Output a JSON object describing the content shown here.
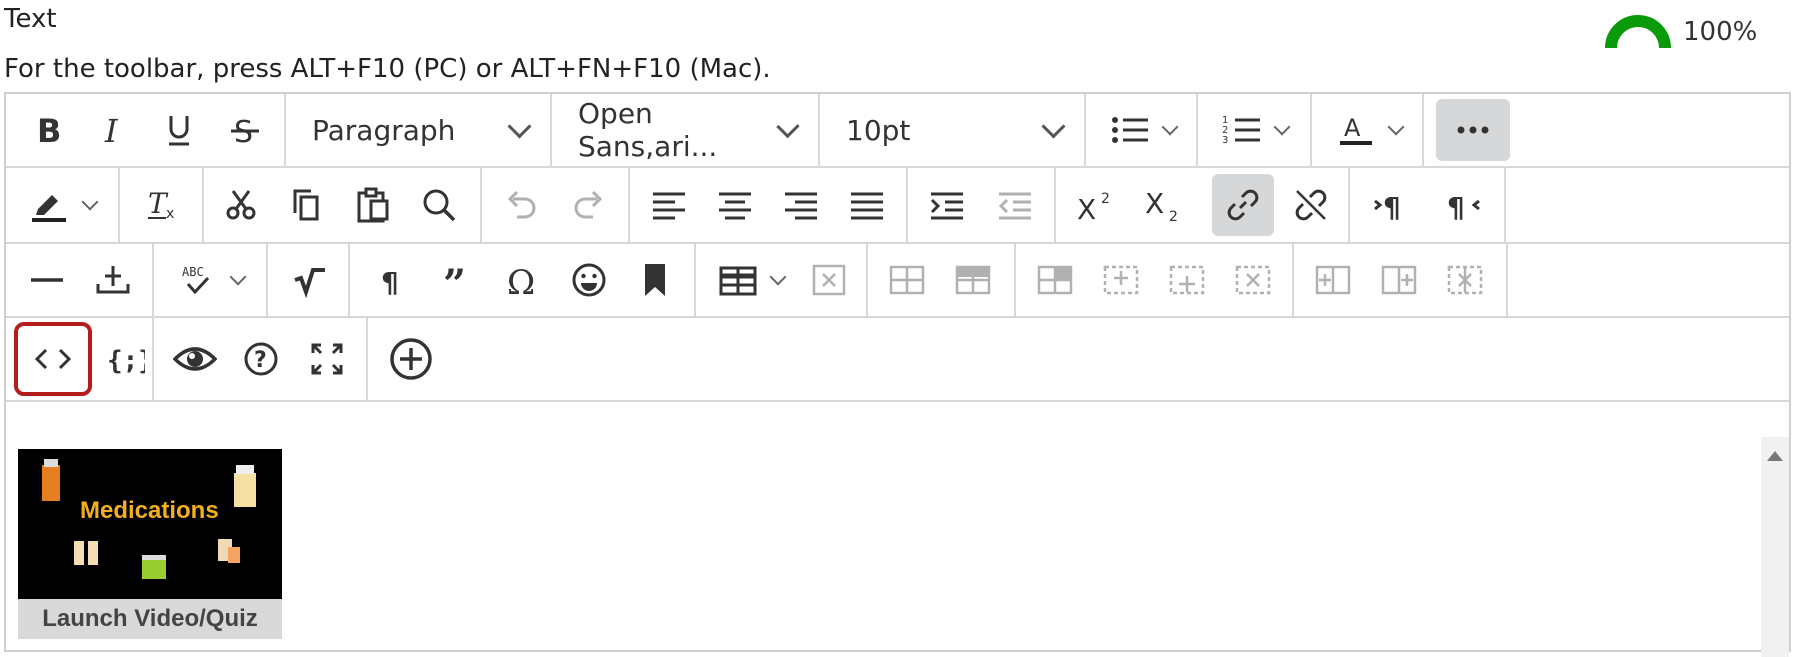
{
  "field": {
    "label": "Text",
    "hint": "For the toolbar, press ALT+F10 (PC) or ALT+FN+F10 (Mac)."
  },
  "progress": {
    "text": "100%",
    "value": 1.0,
    "color": "#0a9a0a"
  },
  "toolbar": {
    "block_format": "Paragraph",
    "font_family": "Open Sans,ari...",
    "font_size": "10pt"
  },
  "content": {
    "thumbnail_title": "Medications",
    "launch_label": "Launch Video/Quiz"
  },
  "icons": [
    "bold-icon",
    "italic-icon",
    "underline-icon",
    "strikethrough-icon",
    "bullet-list-icon",
    "numbered-list-icon",
    "text-color-icon",
    "more-icon",
    "highlight-icon",
    "clear-format-icon",
    "cut-icon",
    "copy-icon",
    "paste-icon",
    "find-icon",
    "undo-icon",
    "redo-icon",
    "align-left-icon",
    "align-center-icon",
    "align-right-icon",
    "justify-icon",
    "indent-icon",
    "outdent-icon",
    "superscript-icon",
    "subscript-icon",
    "link-icon",
    "unlink-icon",
    "ltr-icon",
    "rtl-icon",
    "horizontal-line-icon",
    "insert-icon",
    "spellcheck-icon",
    "math-icon",
    "paragraph-mark-icon",
    "blockquote-icon",
    "omega-icon",
    "emoji-icon",
    "bookmark-icon",
    "table-icon",
    "delete-table-icon",
    "table-row-before-icon",
    "table-row-after-icon",
    "table-cell-icon",
    "table-insert-row-icon",
    "table-insert-col-icon",
    "table-delete-icon",
    "table-col-before-icon",
    "table-col-after-icon",
    "table-delete-col-icon",
    "source-code-icon",
    "code-sample-icon",
    "preview-icon",
    "help-icon",
    "fullscreen-icon",
    "add-content-icon"
  ]
}
